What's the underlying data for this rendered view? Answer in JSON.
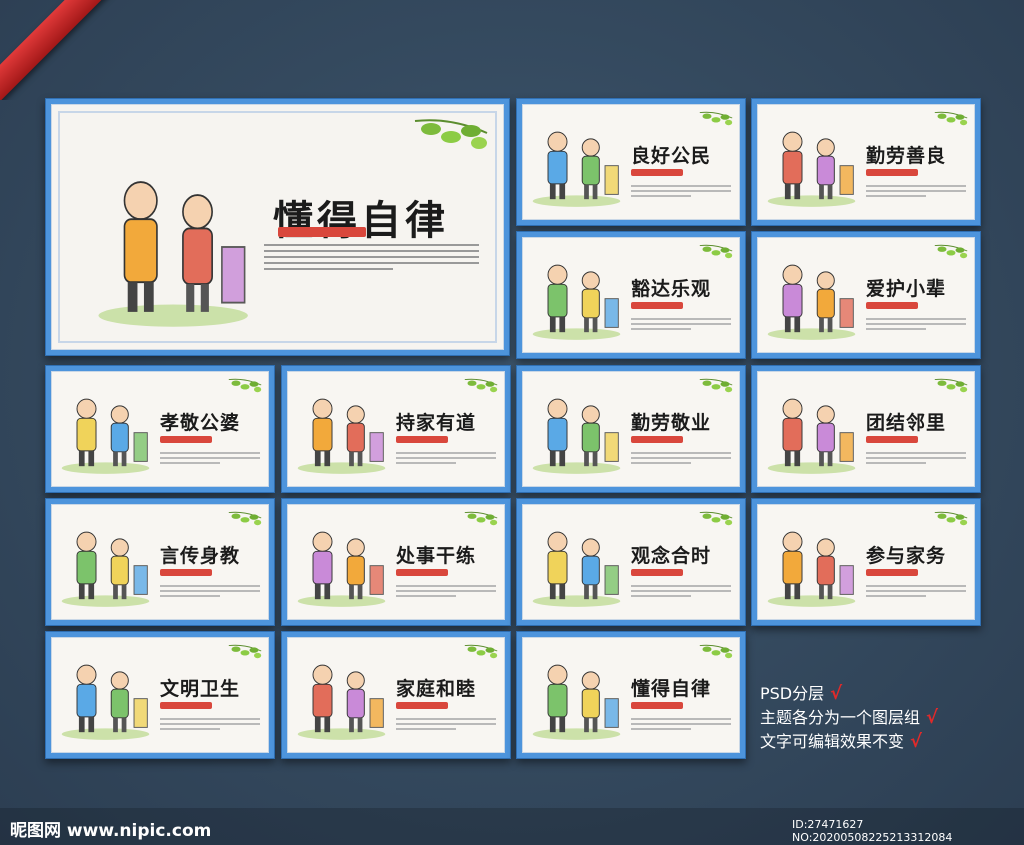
{
  "panels": [
    {
      "title": "懂得自律",
      "big": true
    },
    {
      "title": "良好公民"
    },
    {
      "title": "勤劳善良"
    },
    {
      "title": "豁达乐观"
    },
    {
      "title": "爱护小辈"
    },
    {
      "title": "孝敬公婆"
    },
    {
      "title": "持家有道"
    },
    {
      "title": "勤劳敬业"
    },
    {
      "title": "团结邻里"
    },
    {
      "title": "言传身教"
    },
    {
      "title": "处事干练"
    },
    {
      "title": "观念合时"
    },
    {
      "title": "参与家务"
    },
    {
      "title": "文明卫生"
    },
    {
      "title": "家庭和睦"
    },
    {
      "title": "懂得自律"
    }
  ],
  "notes": {
    "line1": "PSD分层",
    "line2": "主题各分为一个图层组",
    "line3": "文字可编辑效果不变",
    "check": "√"
  },
  "footer": {
    "logo": "昵图网 www.nipic.com",
    "id": "ID:27471627 NO:20200508225213312084"
  },
  "colors": {
    "frame": "#4d94dc",
    "accent": "#d9473c",
    "background": "#34495e"
  }
}
